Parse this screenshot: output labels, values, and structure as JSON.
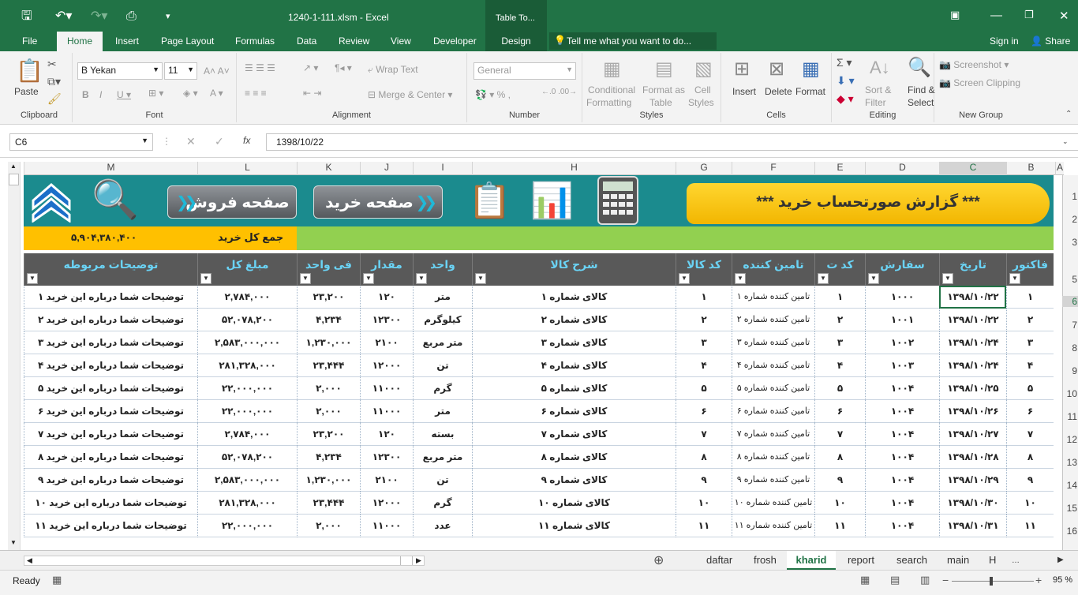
{
  "app": {
    "title": "1240-1-111.xlsm - Excel",
    "context_tab": "Table To...",
    "sign_in": "Sign in",
    "share": "Share"
  },
  "tabs": [
    "File",
    "Home",
    "Insert",
    "Page Layout",
    "Formulas",
    "Data",
    "Review",
    "View",
    "Developer",
    "Design"
  ],
  "tell_me": "Tell me what you want to do...",
  "ribbon": {
    "clipboard": {
      "label": "Clipboard",
      "paste": "Paste"
    },
    "font": {
      "label": "Font",
      "name": "B Yekan",
      "size": "11"
    },
    "alignment": {
      "label": "Alignment",
      "wrap": "Wrap Text",
      "merge": "Merge & Center"
    },
    "number": {
      "label": "Number",
      "format": "General"
    },
    "styles": {
      "label": "Styles",
      "cond1": "Conditional",
      "cond2": "Formatting",
      "fmt1": "Format as",
      "fmt2": "Table",
      "cell1": "Cell",
      "cell2": "Styles"
    },
    "cells": {
      "label": "Cells",
      "insert": "Insert",
      "delete": "Delete",
      "format": "Format"
    },
    "editing": {
      "label": "Editing",
      "sort1": "Sort &",
      "sort2": "Filter",
      "find1": "Find &",
      "find2": "Select"
    },
    "newgroup": {
      "label": "New Group",
      "shot": "Screenshot",
      "clip": "Screen Clipping"
    }
  },
  "formula_bar": {
    "name_box": "C6",
    "fx": "fx",
    "value": "1398/10/22"
  },
  "columns": [
    "M",
    "L",
    "K",
    "J",
    "I",
    "H",
    "G",
    "F",
    "E",
    "D",
    "C",
    "B",
    "A"
  ],
  "row_numbers": [
    "1",
    "2",
    "3",
    "5",
    "6",
    "7",
    "8",
    "9",
    "10",
    "11",
    "12",
    "13",
    "14",
    "15",
    "16"
  ],
  "banner": {
    "title": "*** گزارش صورتحساب خرید ***",
    "sale_btn": "صفحه فروش",
    "buy_btn": "صفحه خرید",
    "arrows": "❯❯"
  },
  "total": {
    "label": "جمع کل خرید",
    "value": "۵,۹۰۴,۳۸۰,۴۰۰"
  },
  "table": {
    "headers": [
      "توضیحات مربوطه",
      "مبلغ کل",
      "فی واحد",
      "مقدار",
      "واحد",
      "شرح کالا",
      "کد کالا",
      "تامین کننده",
      "کد ت",
      "سفارش",
      "تاریخ",
      "فاکتور"
    ],
    "rows": [
      [
        "توضیحات شما درباره این خرید ۱",
        "۲,۷۸۴,۰۰۰",
        "۲۳,۲۰۰",
        "۱۲۰",
        "متر",
        "کالای شماره ۱",
        "۱",
        "تامین کننده شماره ۱",
        "۱",
        "۱۰۰۰",
        "۱۳۹۸/۱۰/۲۲",
        "۱"
      ],
      [
        "توضیحات شما درباره این خرید ۲",
        "۵۲,۰۷۸,۲۰۰",
        "۴,۲۳۴",
        "۱۲۳۰۰",
        "کیلوگرم",
        "کالای شماره ۲",
        "۲",
        "تامین کننده شماره ۲",
        "۲",
        "۱۰۰۱",
        "۱۳۹۸/۱۰/۲۲",
        "۲"
      ],
      [
        "توضیحات شما درباره این خرید ۳",
        "۲,۵۸۳,۰۰۰,۰۰۰",
        "۱,۲۳۰,۰۰۰",
        "۲۱۰۰",
        "متر مربع",
        "کالای شماره ۳",
        "۳",
        "تامین کننده شماره ۳",
        "۳",
        "۱۰۰۲",
        "۱۳۹۸/۱۰/۲۴",
        "۳"
      ],
      [
        "توضیحات شما درباره این خرید ۴",
        "۲۸۱,۳۲۸,۰۰۰",
        "۲۳,۴۴۴",
        "۱۲۰۰۰",
        "تن",
        "کالای شماره ۴",
        "۴",
        "تامین کننده شماره ۴",
        "۴",
        "۱۰۰۳",
        "۱۳۹۸/۱۰/۲۴",
        "۴"
      ],
      [
        "توضیحات شما درباره این خرید ۵",
        "۲۲,۰۰۰,۰۰۰",
        "۲,۰۰۰",
        "۱۱۰۰۰",
        "گرم",
        "کالای شماره ۵",
        "۵",
        "تامین کننده شماره ۵",
        "۵",
        "۱۰۰۴",
        "۱۳۹۸/۱۰/۲۵",
        "۵"
      ],
      [
        "توضیحات شما درباره این خرید ۶",
        "۲۲,۰۰۰,۰۰۰",
        "۲,۰۰۰",
        "۱۱۰۰۰",
        "متر",
        "کالای شماره ۶",
        "۶",
        "تامین کننده شماره ۶",
        "۶",
        "۱۰۰۴",
        "۱۳۹۸/۱۰/۲۶",
        "۶"
      ],
      [
        "توضیحات شما درباره این خرید ۷",
        "۲,۷۸۴,۰۰۰",
        "۲۳,۲۰۰",
        "۱۲۰",
        "بسته",
        "کالای شماره ۷",
        "۷",
        "تامین کننده شماره ۷",
        "۷",
        "۱۰۰۴",
        "۱۳۹۸/۱۰/۲۷",
        "۷"
      ],
      [
        "توضیحات شما درباره این خرید ۸",
        "۵۲,۰۷۸,۲۰۰",
        "۴,۲۳۴",
        "۱۲۳۰۰",
        "متر مربع",
        "کالای شماره ۸",
        "۸",
        "تامین کننده شماره ۸",
        "۸",
        "۱۰۰۴",
        "۱۳۹۸/۱۰/۲۸",
        "۸"
      ],
      [
        "توضیحات شما درباره این خرید ۹",
        "۲,۵۸۳,۰۰۰,۰۰۰",
        "۱,۲۳۰,۰۰۰",
        "۲۱۰۰",
        "تن",
        "کالای شماره ۹",
        "۹",
        "تامین کننده شماره ۹",
        "۹",
        "۱۰۰۴",
        "۱۳۹۸/۱۰/۲۹",
        "۹"
      ],
      [
        "توضیحات شما درباره این خرید ۱۰",
        "۲۸۱,۳۲۸,۰۰۰",
        "۲۳,۴۴۴",
        "۱۲۰۰۰",
        "گرم",
        "کالای شماره ۱۰",
        "۱۰",
        "تامین کننده شماره ۱۰",
        "۱۰",
        "۱۰۰۴",
        "۱۳۹۸/۱۰/۳۰",
        "۱۰"
      ],
      [
        "توضیحات شما درباره این خرید ۱۱",
        "۲۲,۰۰۰,۰۰۰",
        "۲,۰۰۰",
        "۱۱۰۰۰",
        "عدد",
        "کالای شماره ۱۱",
        "۱۱",
        "تامین کننده شماره ۱۱",
        "۱۱",
        "۱۰۰۴",
        "۱۳۹۸/۱۰/۳۱",
        "۱۱"
      ]
    ]
  },
  "sheet_tabs": [
    "daftar",
    "frosh",
    "kharid",
    "report",
    "search",
    "main",
    "H"
  ],
  "active_tab": "kharid",
  "status": {
    "ready": "Ready",
    "zoom": "95 %"
  },
  "colors": {
    "excel_green": "#217346",
    "banner_teal": "#1b8b8e",
    "header_gray": "#595959",
    "header_text": "#6ad3f5",
    "total_yellow": "#ffc000",
    "total_green": "#92d050"
  }
}
